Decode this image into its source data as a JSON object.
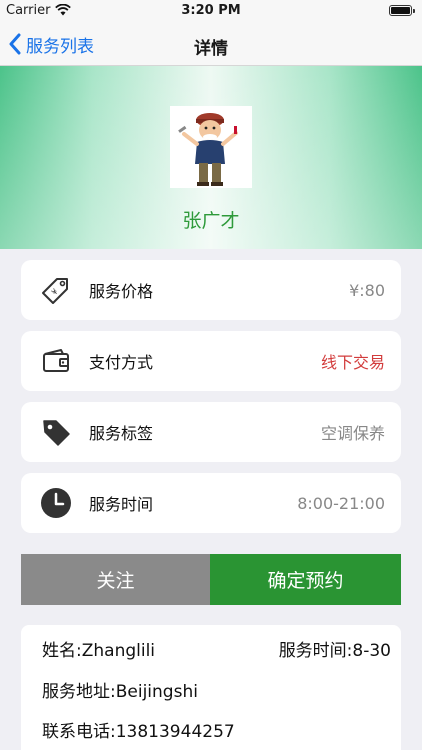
{
  "status_bar": {
    "carrier": "Carrier",
    "time": "3:20 PM"
  },
  "nav": {
    "back_label": "服务列表",
    "title": "详情"
  },
  "provider": {
    "name": "张广才",
    "avatar_icon": "repairman-avatar-icon"
  },
  "details": [
    {
      "icon": "price-tag-icon",
      "label": "服务价格",
      "value": "¥:80",
      "value_color": "#888888"
    },
    {
      "icon": "wallet-icon",
      "label": "支付方式",
      "value": "线下交易",
      "value_color": "#d23c3c"
    },
    {
      "icon": "tag-icon",
      "label": "服务标签",
      "value": "空调保养",
      "value_color": "#888888"
    },
    {
      "icon": "clock-icon",
      "label": "服务时间",
      "value": "8:00-21:00",
      "value_color": "#888888"
    }
  ],
  "actions": {
    "follow_label": "关注",
    "book_label": "确定预约",
    "follow_color": "#8a8a8a",
    "book_color": "#2a9433"
  },
  "info": {
    "name": "姓名:Zhanglili",
    "service_time": "服务时间:8-30",
    "address": "服务地址:Beijingshi",
    "phone": "联系电话:13813944257"
  },
  "colors": {
    "accent_blue": "#1a73e8",
    "header_green": "#4cc38a",
    "name_green": "#2e9a3a"
  }
}
